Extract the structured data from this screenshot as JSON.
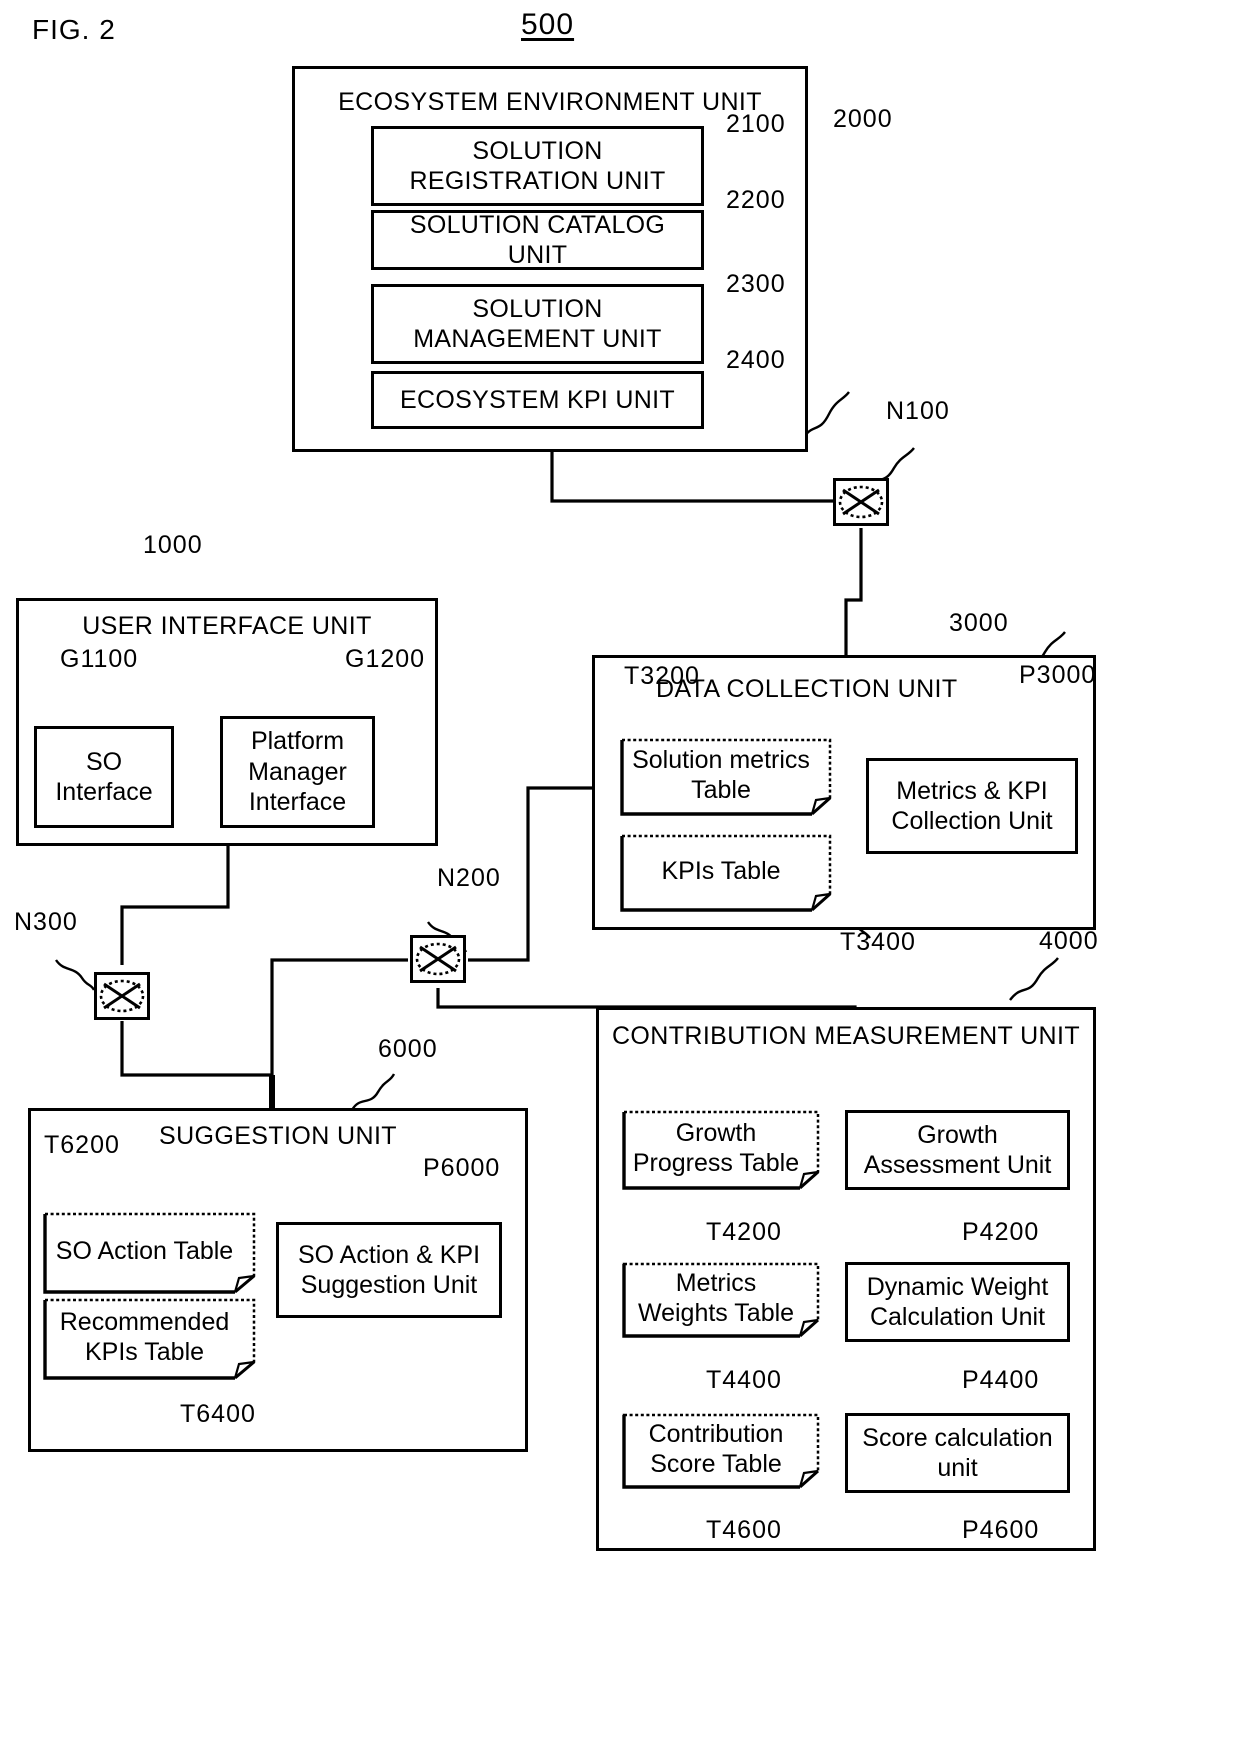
{
  "figure": {
    "fig_label": "FIG. 2",
    "system_ref": "500"
  },
  "units": {
    "ecosystem": {
      "title": "ECOSYSTEM ENVIRONMENT UNIT",
      "ref": "2000",
      "children": [
        {
          "label": "SOLUTION REGISTRATION UNIT",
          "ref": "2100"
        },
        {
          "label": "SOLUTION CATALOG UNIT",
          "ref": "2200"
        },
        {
          "label": "SOLUTION MANAGEMENT UNIT",
          "ref": "2300"
        },
        {
          "label": "ECOSYSTEM KPI UNIT",
          "ref": "2400"
        }
      ]
    },
    "user_interface": {
      "title": "USER INTERFACE UNIT",
      "ref": "1000",
      "children": [
        {
          "label": "SO Interface",
          "ref": "G1100"
        },
        {
          "label": "Platform Manager Interface",
          "ref": "G1200"
        }
      ]
    },
    "data_collection": {
      "title": "DATA COLLECTION UNIT",
      "ref": "3000",
      "tables": [
        {
          "label": "Solution metrics Table",
          "ref": "T3200"
        },
        {
          "label": "KPIs Table",
          "ref": "T3400"
        }
      ],
      "processes": [
        {
          "label": "Metrics & KPI Collection Unit",
          "ref": "P3000"
        }
      ]
    },
    "suggestion": {
      "title": "SUGGESTION UNIT",
      "ref": "6000",
      "tables": [
        {
          "label": "SO Action Table",
          "ref": "T6200"
        },
        {
          "label": "Recommended KPIs Table",
          "ref": "T6400"
        }
      ],
      "processes": [
        {
          "label": "SO Action & KPI Suggestion Unit",
          "ref": "P6000"
        }
      ]
    },
    "contribution": {
      "title": "CONTRIBUTION MEASUREMENT UNIT",
      "ref": "4000",
      "tables": [
        {
          "label": "Growth Progress Table",
          "ref": "T4200"
        },
        {
          "label": "Metrics Weights Table",
          "ref": "T4400"
        },
        {
          "label": "Contribution Score Table",
          "ref": "T4600"
        }
      ],
      "processes": [
        {
          "label": "Growth Assessment Unit",
          "ref": "P4200"
        },
        {
          "label": "Dynamic Weight Calculation Unit",
          "ref": "P4400"
        },
        {
          "label": "Score  calculation unit",
          "ref": "P4600"
        }
      ]
    }
  },
  "network_nodes": [
    {
      "ref": "N100",
      "name": "network-node-n100"
    },
    {
      "ref": "N200",
      "name": "network-node-n200"
    },
    {
      "ref": "N300",
      "name": "network-node-n300"
    }
  ],
  "style": {
    "stroke": "#000000",
    "background": "#ffffff"
  }
}
